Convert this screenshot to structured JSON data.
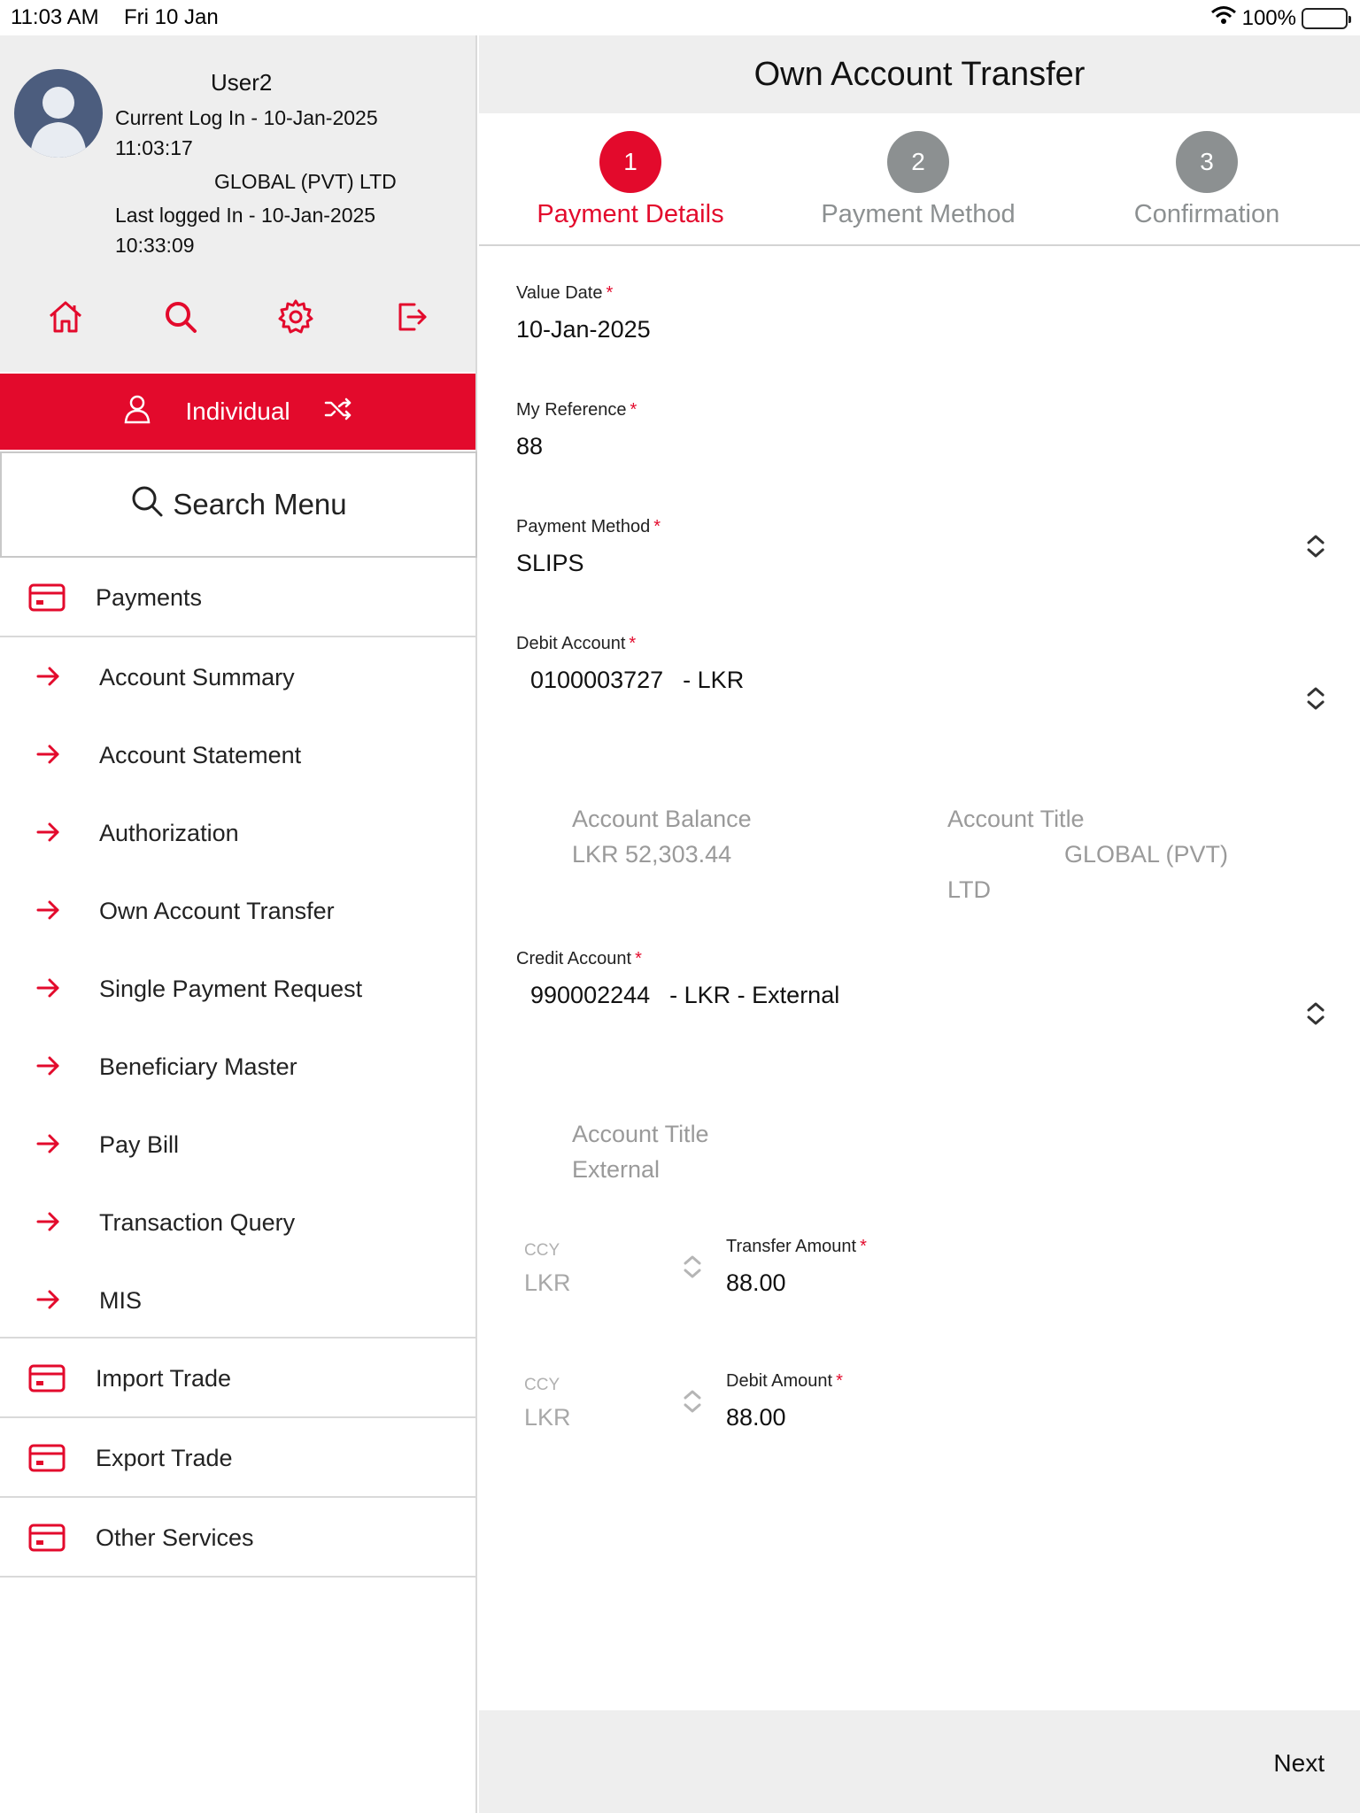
{
  "status_bar": {
    "time": "11:03 AM",
    "date": "Fri 10 Jan",
    "battery": "100%"
  },
  "profile": {
    "username": "User2",
    "current_login_1": "Current Log In - 10-Jan-2025",
    "current_login_2": "11:03:17",
    "company": "GLOBAL (PVT) LTD",
    "last_login_1": "Last logged In - 10-Jan-2025",
    "last_login_2": "10:33:09",
    "icons": [
      "home-icon",
      "search-icon",
      "gear-icon",
      "logout-icon"
    ]
  },
  "mode": {
    "label": "Individual"
  },
  "search_menu": {
    "label": "Search Menu"
  },
  "menu": {
    "payments": "Payments",
    "subitems": [
      "Account Summary",
      "Account Statement",
      "Authorization",
      "Own Account Transfer",
      "Single Payment Request",
      "Beneficiary Master",
      "Pay Bill",
      "Transaction Query",
      "MIS"
    ],
    "import_trade": "Import Trade",
    "export_trade": "Export Trade",
    "other_services": "Other Services"
  },
  "header": {
    "title": "Own Account Transfer"
  },
  "steps": [
    {
      "number": "1",
      "label": "Payment Details"
    },
    {
      "number": "2",
      "label": "Payment Method"
    },
    {
      "number": "3",
      "label": "Confirmation"
    }
  ],
  "form": {
    "value_date": {
      "label": "Value Date",
      "value": "10-Jan-2025"
    },
    "my_reference": {
      "label": "My Reference",
      "value": "88"
    },
    "payment_method": {
      "label": "Payment Method",
      "value": "SLIPS"
    },
    "debit_account": {
      "label": "Debit Account",
      "number": "0100003727",
      "suffix": "- LKR",
      "balance_label": "Account Balance",
      "balance_value": "LKR 52,303.44",
      "title_label": "Account Title",
      "title_value_1": "GLOBAL (PVT)",
      "title_value_2": "LTD"
    },
    "credit_account": {
      "label": "Credit Account",
      "number": "990002244",
      "suffix": "- LKR - External",
      "title_label": "Account Title",
      "title_value": "External"
    },
    "transfer": {
      "ccy_label": "CCY",
      "ccy_value": "LKR",
      "label": "Transfer Amount",
      "value": "88.00"
    },
    "debit_amount": {
      "ccy_label": "CCY",
      "ccy_value": "LKR",
      "label": "Debit Amount",
      "value": "88.00"
    },
    "required_mark": "*"
  },
  "footer": {
    "next_label": "Next"
  },
  "colors": {
    "accent": "#e30a2c",
    "inactive_step": "#8c9091",
    "panel_gray": "#eeeeee"
  }
}
